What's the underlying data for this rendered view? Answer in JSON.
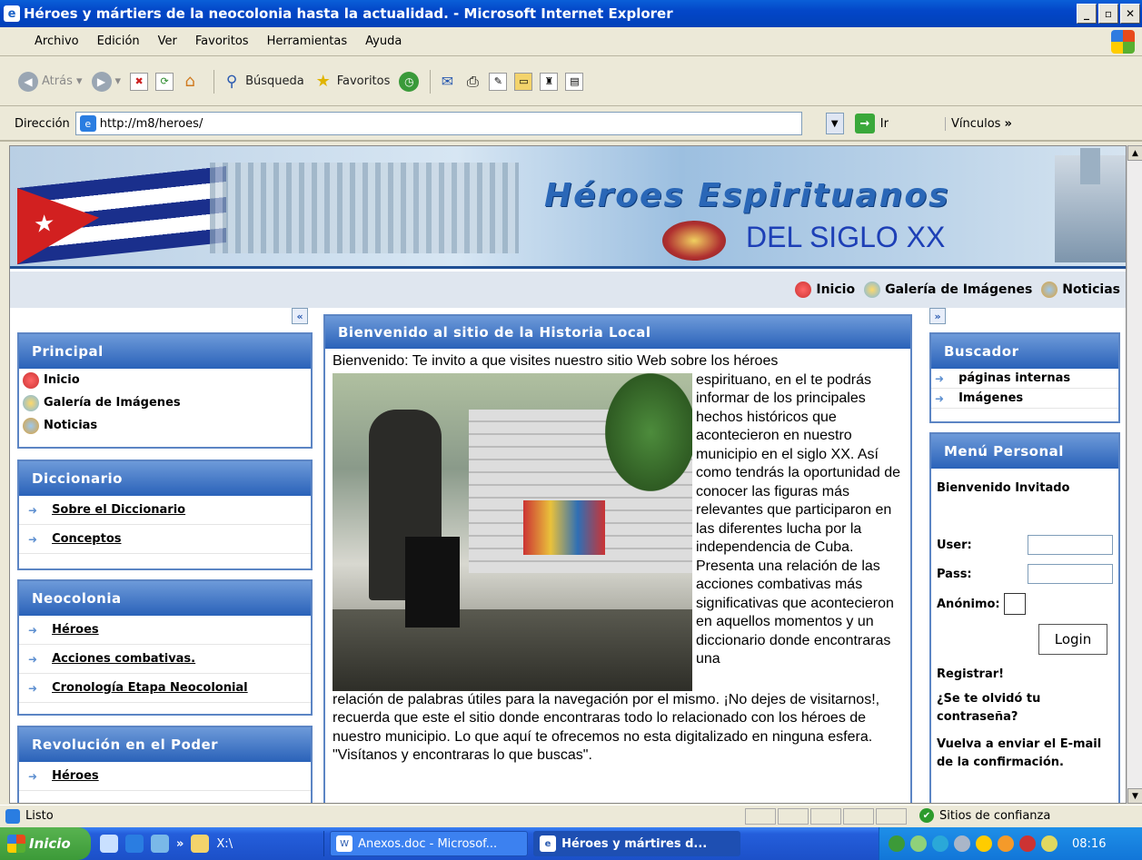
{
  "window": {
    "title": "Héroes y mártiers de la neocolonia hasta la actualidad. - Microsoft Internet Explorer"
  },
  "menu": [
    "Archivo",
    "Edición",
    "Ver",
    "Favoritos",
    "Herramientas",
    "Ayuda"
  ],
  "toolbar": {
    "back": "Atrás",
    "search": "Búsqueda",
    "favorites": "Favoritos"
  },
  "address": {
    "label": "Dirección",
    "url": "http://m8/heroes/",
    "go": "Ir",
    "links": "Vínculos"
  },
  "banner": {
    "title": "Héroes Espirituanos",
    "subtitle": "DEL SIGLO XX"
  },
  "topnav": [
    "Inicio",
    "Galería de Imágenes",
    "Noticias"
  ],
  "left": {
    "principal": {
      "title": "Principal",
      "items": [
        "Inicio",
        "Galería de Imágenes",
        "Noticias"
      ]
    },
    "diccionario": {
      "title": "Diccionario",
      "items": [
        "Sobre el Diccionario",
        "Conceptos"
      ]
    },
    "neocolonia": {
      "title": "Neocolonia",
      "items": [
        "Héroes",
        "Acciones combativas.",
        "Cronología Etapa Neocolonial"
      ]
    },
    "revolucion": {
      "title": "Revolución en el Poder",
      "items": [
        "Héroes"
      ]
    }
  },
  "main": {
    "title": "Bienvenido al sitio de la Historia Local",
    "intro": "Bienvenido: Te invito a que visites nuestro sitio Web sobre los héroes",
    "side_text": "espirituano, en el te podrás informar de los principales hechos históricos que acontecieron en nuestro municipio en el siglo XX. Así como tendrás la oportunidad de conocer las figuras más relevantes que participaron en las diferentes lucha por la independencia de Cuba. Presenta una relación de las acciones combativas más significativas que acontecieron en aquellos momentos y un diccionario donde encontraras una",
    "bottom_text": "relación de palabras útiles para la navegación por el mismo. ¡No dejes de visitarnos!, recuerda que este el sitio donde encontraras todo lo relacionado con los héroes de nuestro municipio. Lo que aquí te ofrecemos no esta digitalizado en ninguna esfera. \"Visítanos y encontraras lo que buscas\"."
  },
  "right": {
    "buscador": {
      "title": "Buscador",
      "items": [
        "páginas internas",
        "Imágenes"
      ]
    },
    "personal": {
      "title": "Menú Personal",
      "welcome": "Bienvenido Invitado",
      "user": "User:",
      "pass": "Pass:",
      "anon": "Anónimo:",
      "login": "Login",
      "register": "Registrar!",
      "forgot": "¿Se te olvidó tu contraseña?",
      "resend": "Vuelva a enviar el E-mail de la confirmación."
    }
  },
  "status": {
    "text": "Listo",
    "zone": "Sitios de confianza"
  },
  "taskbar": {
    "start": "Inicio",
    "ql_folder": "X:\\",
    "tasks": [
      "Anexos.doc - Microsof...",
      "Héroes y mártires d..."
    ],
    "time": "08:16"
  }
}
